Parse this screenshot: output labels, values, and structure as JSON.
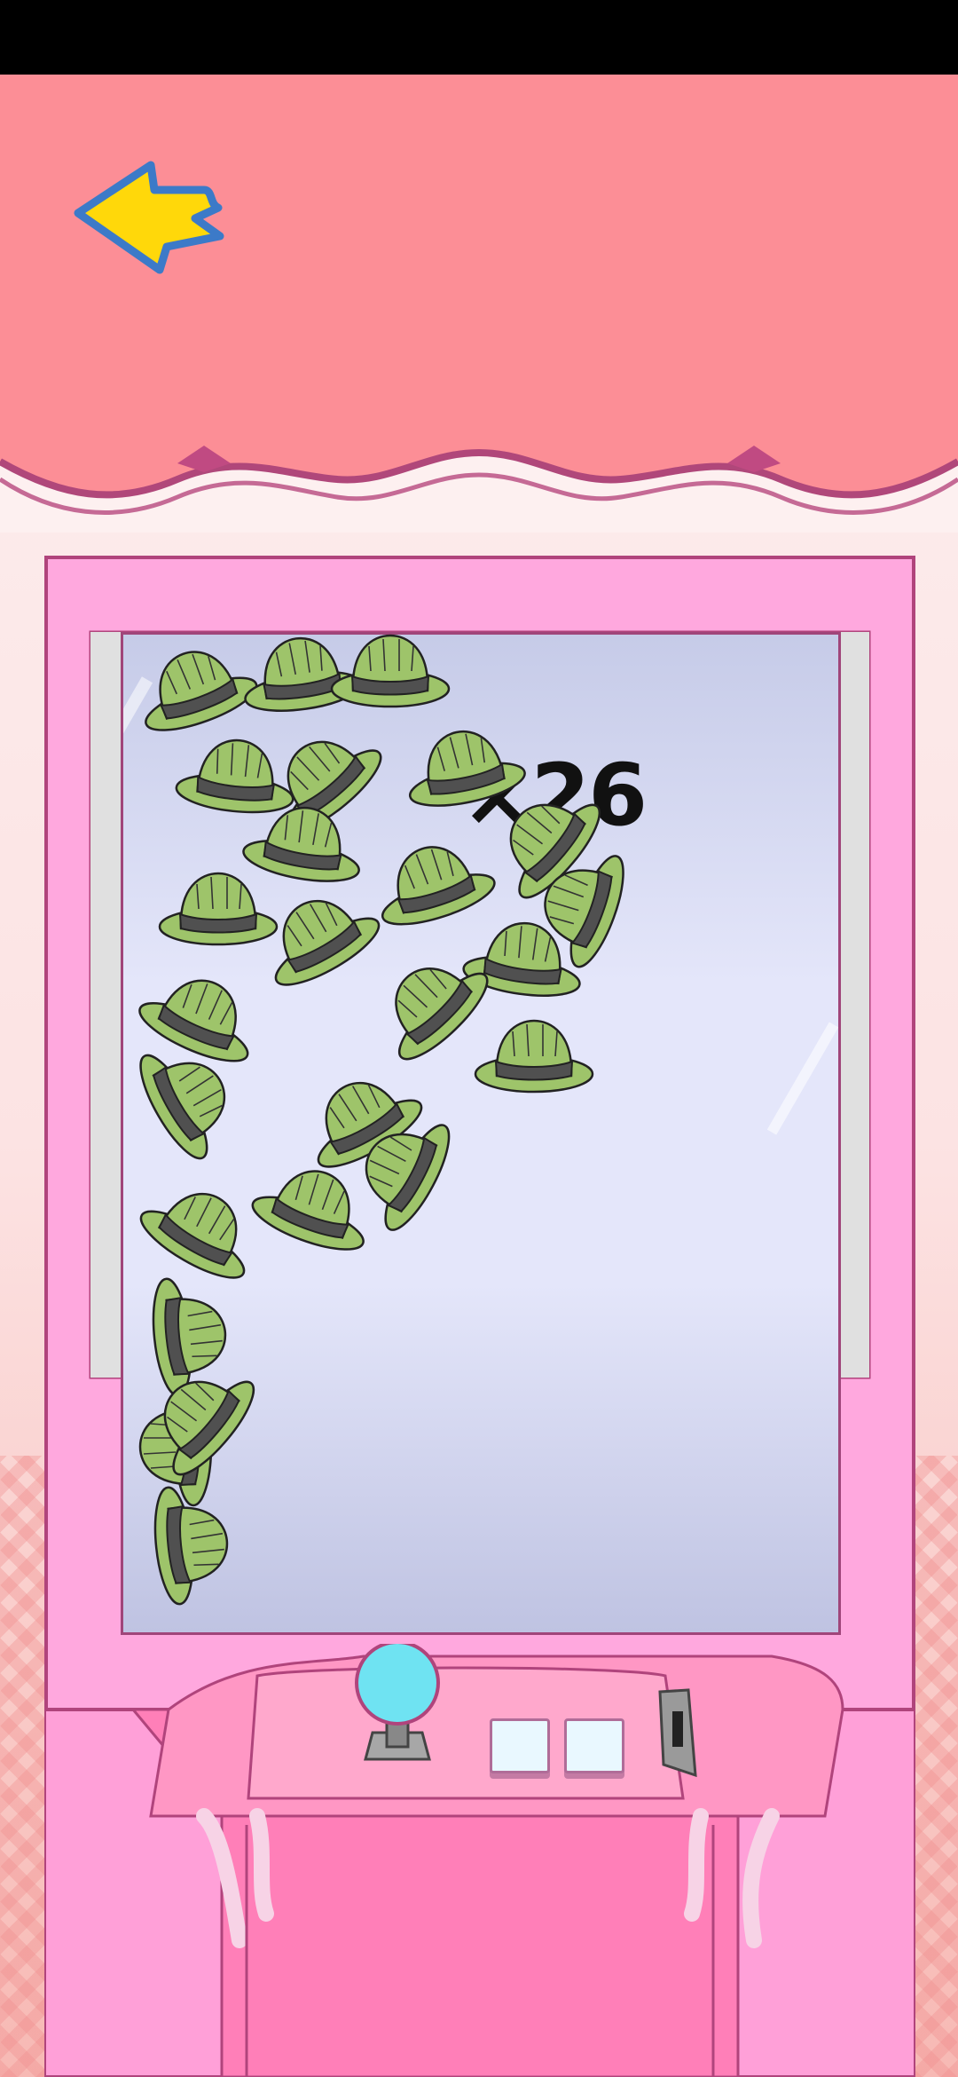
{
  "hud": {
    "remaining_count": "×26"
  },
  "icons": {
    "back": "left-arrow-icon",
    "item": "bucket-hat-icon",
    "joystick": "joystick-icon",
    "coin": "coin-slot-icon"
  },
  "colors": {
    "top_band": "#fc8e96",
    "machine_frame": "#ffa8de",
    "hat_fill": "#9ec46a",
    "hat_band": "#505050",
    "arrow_fill": "#ffd80a",
    "arrow_outline": "#3c7ac8",
    "joystick_ball": "#6fe3f2"
  },
  "machine": {
    "buttons": [
      "control-button-1",
      "control-button-2"
    ]
  }
}
